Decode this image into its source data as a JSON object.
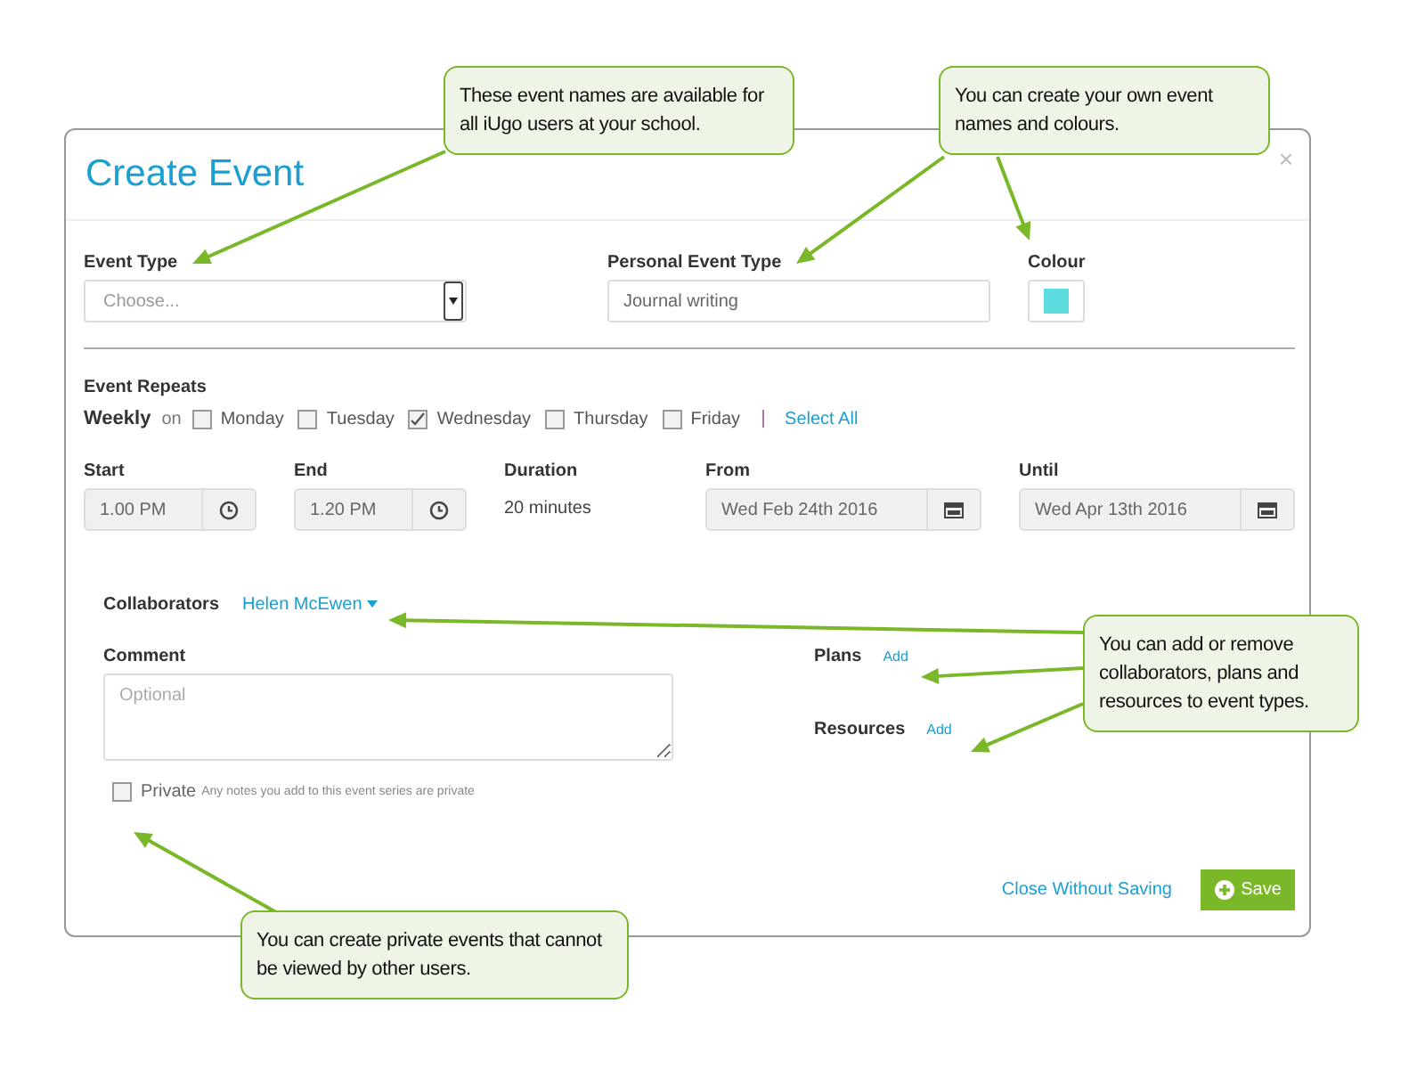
{
  "dialog": {
    "title": "Create Event",
    "close": "×",
    "event_type": {
      "label": "Event Type",
      "placeholder": "Choose..."
    },
    "personal_event_type": {
      "label": "Personal Event Type",
      "value": "Journal writing"
    },
    "colour": {
      "label": "Colour",
      "color": "#5ddde0"
    },
    "repeats": {
      "label": "Event Repeats",
      "frequency": "Weekly",
      "on": "on",
      "days": [
        {
          "label": "Monday",
          "checked": false
        },
        {
          "label": "Tuesday",
          "checked": false
        },
        {
          "label": "Wednesday",
          "checked": true
        },
        {
          "label": "Thursday",
          "checked": false
        },
        {
          "label": "Friday",
          "checked": false
        }
      ],
      "select_all": "Select All"
    },
    "start": {
      "label": "Start",
      "value": "1.00 PM"
    },
    "end": {
      "label": "End",
      "value": "1.20 PM"
    },
    "duration": {
      "label": "Duration",
      "value": "20 minutes"
    },
    "from": {
      "label": "From",
      "value": "Wed Feb 24th 2016"
    },
    "until": {
      "label": "Until",
      "value": "Wed Apr 13th 2016"
    },
    "collaborators": {
      "label": "Collaborators",
      "value": "Helen McEwen"
    },
    "comment": {
      "label": "Comment",
      "placeholder": "Optional"
    },
    "plans": {
      "label": "Plans",
      "link": "Add"
    },
    "resources": {
      "label": "Resources",
      "link": "Add"
    },
    "private": {
      "label": "Private",
      "checked": false,
      "note": "Any notes you add to this event series are private"
    },
    "buttons": {
      "cancel": "Close Without Saving",
      "save": "Save"
    }
  },
  "callouts": [
    {
      "text": "These event names are available for all iUgo users at your school."
    },
    {
      "text": "You can create your own event names and colours."
    },
    {
      "text": "You can add or remove collaborators, plans and resources to event types."
    },
    {
      "text": "You can create private events that cannot be viewed by other users."
    }
  ]
}
